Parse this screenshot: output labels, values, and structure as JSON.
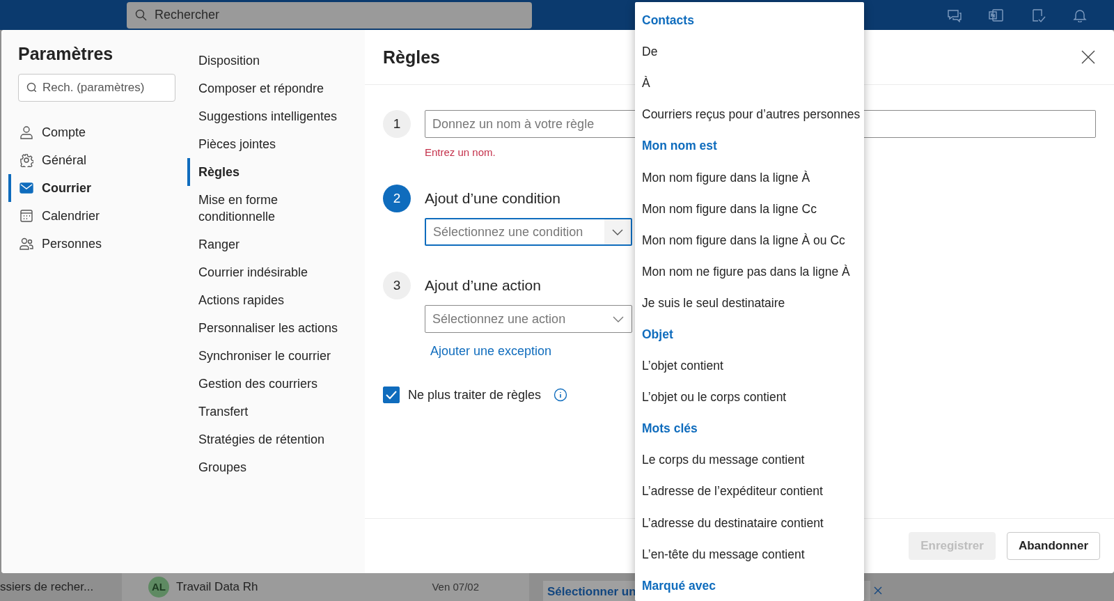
{
  "app": {
    "search": {
      "placeholder": "Rechercher"
    },
    "folder_pane": {
      "text": "ssiers de recher..."
    },
    "message": {
      "avatar": "AL",
      "subject": "Travail Data Rh",
      "date": "Ven 07/02"
    },
    "reading_pane": {
      "text": "Sélectionner un"
    }
  },
  "settings": {
    "title": "Paramètres",
    "search": {
      "placeholder": "Rech. (paramètres)"
    },
    "categories": [
      {
        "label": "Compte",
        "selected": false
      },
      {
        "label": "Général",
        "selected": false
      },
      {
        "label": "Courrier",
        "selected": true
      },
      {
        "label": "Calendrier",
        "selected": false
      },
      {
        "label": "Personnes",
        "selected": false
      }
    ],
    "subcategories": [
      {
        "label": "Disposition",
        "selected": false
      },
      {
        "label": "Composer et répondre",
        "selected": false
      },
      {
        "label": "Suggestions intelligentes",
        "selected": false
      },
      {
        "label": "Pièces jointes",
        "selected": false
      },
      {
        "label": "Règles",
        "selected": true
      },
      {
        "label": "Mise en forme conditionnelle",
        "selected": false
      },
      {
        "label": "Ranger",
        "selected": false
      },
      {
        "label": "Courrier indésirable",
        "selected": false
      },
      {
        "label": "Actions rapides",
        "selected": false
      },
      {
        "label": "Personnaliser les actions",
        "selected": false
      },
      {
        "label": "Synchroniser le courrier",
        "selected": false
      },
      {
        "label": "Gestion des courriers",
        "selected": false
      },
      {
        "label": "Transfert",
        "selected": false
      },
      {
        "label": "Stratégies de rétention",
        "selected": false
      },
      {
        "label": "Groupes",
        "selected": false
      }
    ],
    "panel": {
      "title": "Règles",
      "steps": [
        {
          "kind": "name",
          "number": "1",
          "active": false,
          "placeholder": "Donnez un nom à votre règle",
          "error": "Entrez un nom."
        },
        {
          "kind": "select",
          "number": "2",
          "active": true,
          "title": "Ajout d’une condition",
          "placeholder": "Sélectionnez une condition",
          "focused": true
        },
        {
          "kind": "select",
          "number": "3",
          "active": false,
          "title": "Ajout d’une action",
          "placeholder": "Sélectionnez une action",
          "focused": false
        }
      ],
      "exception_link": "Ajouter une exception",
      "stop_processing": {
        "label": "Ne plus traiter de règles",
        "checked": true
      },
      "buttons": [
        {
          "label": "Enregistrer",
          "disabled": true
        },
        {
          "label": "Abandonner",
          "disabled": false
        }
      ]
    }
  },
  "condition_menu": {
    "items": [
      {
        "kind": "header",
        "label": "Contacts"
      },
      {
        "kind": "option",
        "label": "De"
      },
      {
        "kind": "option",
        "label": "À"
      },
      {
        "kind": "option",
        "label": "Courriers reçus pour d’autres personnes"
      },
      {
        "kind": "header",
        "label": "Mon nom est"
      },
      {
        "kind": "option",
        "label": "Mon nom figure dans la ligne À"
      },
      {
        "kind": "option",
        "label": "Mon nom figure dans la ligne Cc"
      },
      {
        "kind": "option",
        "label": "Mon nom figure dans la ligne À ou Cc"
      },
      {
        "kind": "option",
        "label": "Mon nom ne figure pas dans la ligne À"
      },
      {
        "kind": "option",
        "label": "Je suis le seul destinataire"
      },
      {
        "kind": "header",
        "label": "Objet"
      },
      {
        "kind": "option",
        "label": "L’objet contient"
      },
      {
        "kind": "option",
        "label": "L’objet ou le corps contient"
      },
      {
        "kind": "header",
        "label": "Mots clés"
      },
      {
        "kind": "option",
        "label": "Le corps du message contient"
      },
      {
        "kind": "option",
        "label": "L’adresse de l’expéditeur contient"
      },
      {
        "kind": "option",
        "label": "L’adresse du destinataire contient"
      },
      {
        "kind": "option",
        "label": "L’en-tête du message contient"
      },
      {
        "kind": "header",
        "label": "Marqué avec"
      }
    ]
  }
}
